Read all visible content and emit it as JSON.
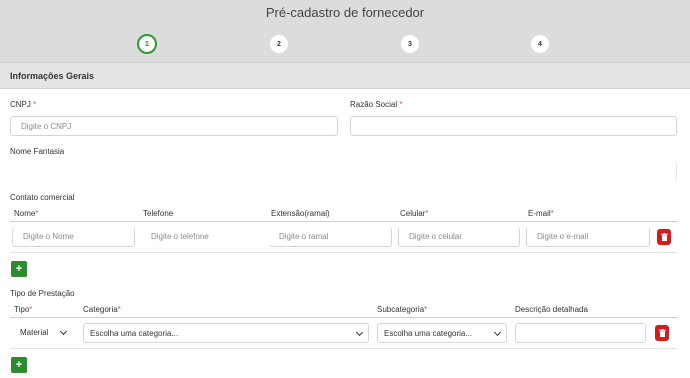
{
  "header": {
    "title": "Pré-cadastro de fornecedor",
    "steps": [
      "1",
      "2",
      "3",
      "4"
    ]
  },
  "section": {
    "title": "Informações Gerais"
  },
  "form": {
    "cnpj": {
      "label": "CNPJ",
      "placeholder": "Digite o CNPJ"
    },
    "razao_social": {
      "label": "Razão Social",
      "value": ""
    },
    "nome_fantasia": {
      "label": "Nome Fantasia",
      "value": ""
    }
  },
  "contato": {
    "title": "Contato comercial",
    "columns": [
      "Nome",
      "Telefone",
      "Extensão(ramal)",
      "Celular",
      "E-mail"
    ],
    "placeholders": [
      "Digite o Nome",
      "Digite o telefone",
      "Digite o ramal",
      "Digite o celular",
      "Digite o e-mail"
    ]
  },
  "prestacao": {
    "title": "Tipo de Prestação",
    "columns": [
      "Tipo",
      "Categoria",
      "Subcategoria",
      "Descrição detalhada"
    ],
    "tipo_value": "Material",
    "categoria_value": "Escolha uma categoria...",
    "subcategoria_value": "Escolha uma categoria..."
  },
  "required_mark": "*",
  "add_label": "+",
  "colors": {
    "accent_green": "#2e8b2e",
    "delete_red": "#d41c1c",
    "required_red": "#d9534f"
  },
  "icons": {
    "add": "plus-icon",
    "delete": "trash-icon",
    "select": "chevron-down-icon"
  }
}
